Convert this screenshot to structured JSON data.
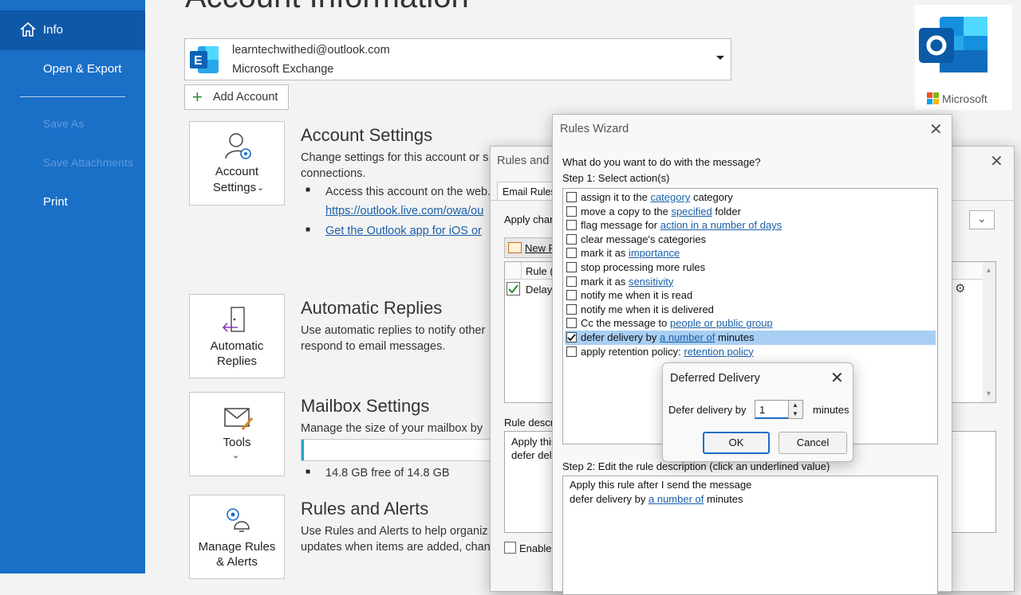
{
  "nav": {
    "items": [
      {
        "label": "Info"
      },
      {
        "label": "Open & Export"
      },
      {
        "label": "Save As"
      },
      {
        "label": "Save Attachments"
      },
      {
        "label": "Print"
      }
    ]
  },
  "page": {
    "title": "Account Information",
    "account": {
      "email": "learntechwithedi@outlook.com",
      "type": "Microsoft Exchange"
    },
    "add_account_label": "Add Account",
    "brand": "Microsoft"
  },
  "sections": {
    "account_settings": {
      "button_line1": "Account",
      "button_line2": "Settings",
      "heading": "Account Settings",
      "desc_line1": "Change settings for this account or s",
      "desc_line2": "connections.",
      "bullet1": "Access this account on the web.",
      "link1": "https://outlook.live.com/owa/ou",
      "link2": "Get the Outlook app for iOS or"
    },
    "auto_replies": {
      "button_line1": "Automatic",
      "button_line2": "Replies",
      "heading": "Automatic Replies",
      "desc_line1": "Use automatic replies to notify other",
      "desc_line2": "respond to email messages."
    },
    "mailbox": {
      "button_label": "Tools",
      "heading": "Mailbox Settings",
      "desc": "Manage the size of your mailbox by",
      "usage_fraction": 0.01,
      "free_text": "14.8 GB free of 14.8 GB"
    },
    "rules": {
      "button_line1": "Manage Rules",
      "button_line2": "& Alerts",
      "heading": "Rules and Alerts",
      "desc_line1": "Use Rules and Alerts to help organiz",
      "desc_line2": "updates when items are added, chan"
    }
  },
  "rules_dialog": {
    "title": "Rules and A",
    "tab": "Email Rules",
    "apply_label": "Apply chan",
    "new_rule": "New R",
    "col_rule": "Rule (",
    "row1": "Delay",
    "desc_label": "Rule descr",
    "desc_line1": "Apply this",
    "desc_line2": "defer del",
    "enable_label": "Enable"
  },
  "wizard": {
    "title": "Rules Wizard",
    "question": "What do you want to do with the message?",
    "step1": "Step 1: Select action(s)",
    "actions": [
      {
        "pre": "assign it to the ",
        "link": "category",
        "post": " category",
        "checked": false
      },
      {
        "pre": "move a copy to the ",
        "link": "specified",
        "post": " folder",
        "checked": false
      },
      {
        "pre": "flag message for ",
        "link": "action in a number of days",
        "post": "",
        "checked": false
      },
      {
        "pre": "clear message's categories",
        "link": "",
        "post": "",
        "checked": false
      },
      {
        "pre": "mark it as ",
        "link": "importance",
        "post": "",
        "checked": false
      },
      {
        "pre": "stop processing more rules",
        "link": "",
        "post": "",
        "checked": false
      },
      {
        "pre": "mark it as ",
        "link": "sensitivity",
        "post": "",
        "checked": false
      },
      {
        "pre": "notify me when it is read",
        "link": "",
        "post": "",
        "checked": false
      },
      {
        "pre": "notify me when it is delivered",
        "link": "",
        "post": "",
        "checked": false
      },
      {
        "pre": "Cc the message to ",
        "link": "people or public group",
        "post": "",
        "checked": false
      },
      {
        "pre": "defer delivery by ",
        "link": "a number of",
        "post": " minutes",
        "checked": true
      },
      {
        "pre": "apply retention policy: ",
        "link": "retention policy",
        "post": "",
        "checked": false
      }
    ],
    "step2": "Step 2: Edit the rule description (click an underlined value)",
    "desc_line1": "Apply this rule after I send the message",
    "desc_pre": "defer delivery by ",
    "desc_link": "a number of",
    "desc_post": " minutes"
  },
  "deferred": {
    "title": "Deferred Delivery",
    "label": "Defer delivery by",
    "value": "1",
    "unit": "minutes",
    "ok": "OK",
    "cancel": "Cancel"
  }
}
